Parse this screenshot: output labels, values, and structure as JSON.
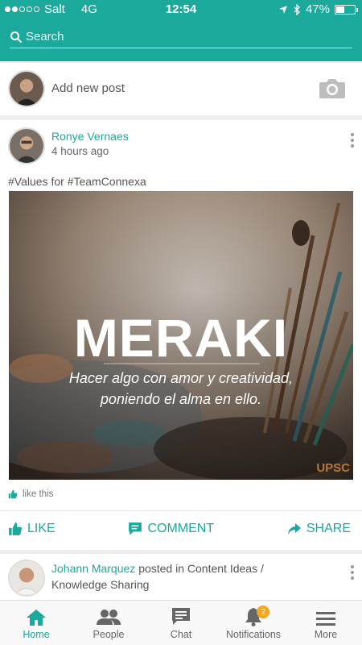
{
  "status_bar": {
    "carrier": "Salt",
    "network": "4G",
    "time": "12:54",
    "battery_percent": "47%",
    "battery_level": 0.47,
    "signal_bars_filled": 2,
    "signal_bars_total": 5
  },
  "search": {
    "placeholder": "Search"
  },
  "composer": {
    "prompt": "Add new post"
  },
  "post1": {
    "author": "Ronye Vernaes",
    "time": "4 hours ago",
    "caption": "#Values for #TeamConnexa",
    "image": {
      "headline": "MERAKI",
      "subline1": "Hacer algo con amor y creatividad,",
      "subline2": "poniendo el alma en ello.",
      "watermark": "UPSC"
    },
    "likes_text": "like this",
    "actions": {
      "like": "LIKE",
      "comment": "COMMENT",
      "share": "SHARE"
    }
  },
  "post2": {
    "author": "Johann Marquez",
    "verb": "posted in",
    "category": "Content Ideas /",
    "category2": "Knowledge Sharing"
  },
  "tabs": [
    {
      "label": "Home",
      "icon": "home-icon",
      "active": true
    },
    {
      "label": "People",
      "icon": "people-icon"
    },
    {
      "label": "Chat",
      "icon": "chat-icon"
    },
    {
      "label": "Notifications",
      "icon": "bell-icon",
      "badge": "2"
    },
    {
      "label": "More",
      "icon": "menu-icon"
    }
  ],
  "colors": {
    "accent": "#1aa99b",
    "badge": "#f5a623"
  }
}
